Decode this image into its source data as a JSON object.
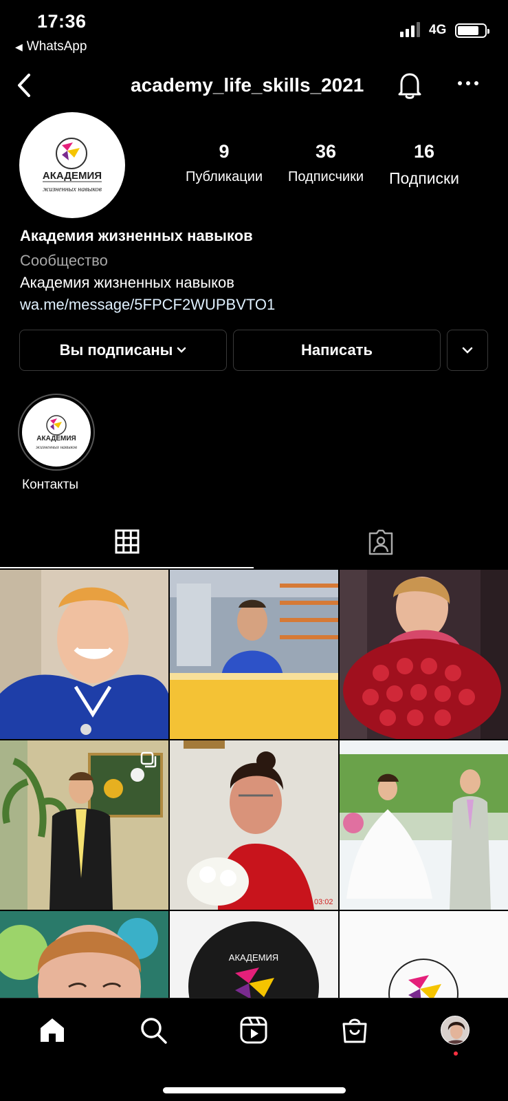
{
  "status_bar": {
    "time": "17:36",
    "back_app": "WhatsApp",
    "network": "4G"
  },
  "header": {
    "username": "academy_life_skills_2021"
  },
  "profile": {
    "logo_line1": "АКАДЕМИЯ",
    "logo_line2": "жизненных навыков",
    "stats": [
      {
        "value": "9",
        "label": "Публикации"
      },
      {
        "value": "36",
        "label": "Подписчики"
      },
      {
        "value": "16",
        "label": "Подписки"
      }
    ],
    "name": "Академия жизненных навыков",
    "category": "Сообщество",
    "bio": "Академия жизненных навыков",
    "link": "wa.me/message/5FPCF2WUPBVTO1"
  },
  "actions": {
    "following_label": "Вы подписаны",
    "message_label": "Написать"
  },
  "highlights": [
    {
      "label": "Контакты"
    }
  ],
  "posts": [
    {
      "subject": "young man in blue hockey jersey smiling"
    },
    {
      "subject": "young man in blue shirt in TV studio"
    },
    {
      "subject": "woman with large bouquet of red roses"
    },
    {
      "subject": "young man in black suit indoors",
      "multi": true
    },
    {
      "subject": "woman in red dress with white bouquet",
      "timestamp": "03:02"
    },
    {
      "subject": "wedding couple in park"
    },
    {
      "subject": "smiling woman close-up"
    },
    {
      "subject": "academy logo circle",
      "text": "АКАДЕМИЯ"
    },
    {
      "subject": "academy logo light"
    }
  ],
  "colors": {
    "link": "#e0f1ff",
    "muted": "#a8a8a8",
    "notification_dot": "#ff3040"
  }
}
